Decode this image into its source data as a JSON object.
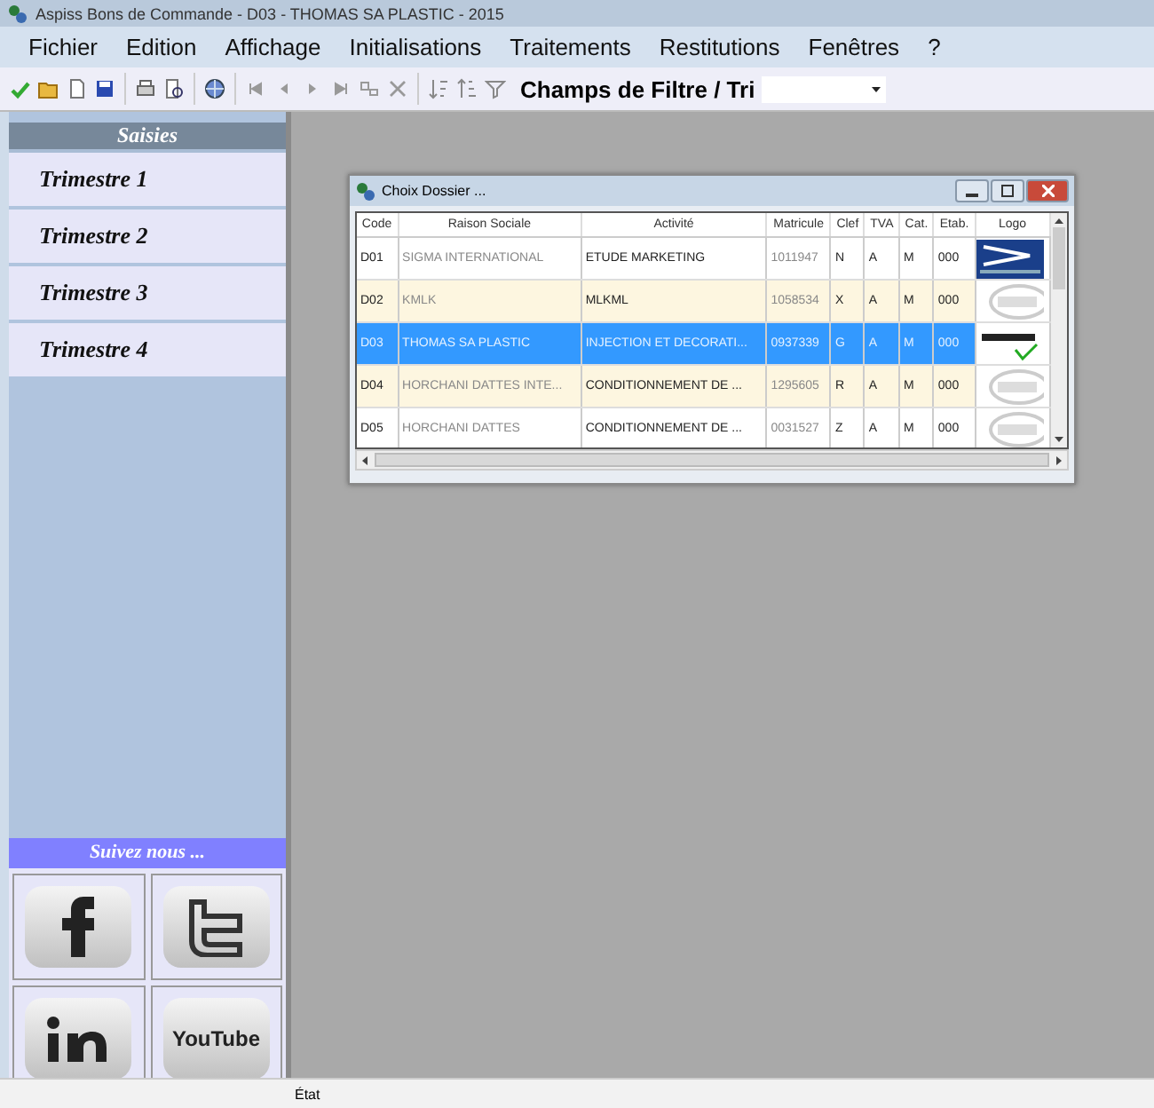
{
  "window": {
    "title": "Aspiss Bons de Commande - D03 - THOMAS SA PLASTIC - 2015"
  },
  "menu": [
    "Fichier",
    "Edition",
    "Affichage",
    "Initialisations",
    "Traitements",
    "Restitutions",
    "Fenêtres",
    "?"
  ],
  "toolbar": {
    "filter_label": "Champs de Filtre / Tri"
  },
  "sidebar": {
    "header": "Saisies",
    "items": [
      {
        "label": "Trimestre 1"
      },
      {
        "label": "Trimestre 2"
      },
      {
        "label": "Trimestre 3"
      },
      {
        "label": "Trimestre 4"
      }
    ],
    "social_header": "Suivez nous ...",
    "social": [
      {
        "kind": "facebook"
      },
      {
        "kind": "twitter"
      },
      {
        "kind": "linkedin"
      },
      {
        "kind": "youtube",
        "label": "YouTube"
      }
    ]
  },
  "dialog": {
    "title": "Choix Dossier ...",
    "columns": [
      "Code",
      "Raison Sociale",
      "Activité",
      "Matricule",
      "Clef",
      "TVA",
      "Cat.",
      "Etab.",
      "Logo"
    ],
    "rows": [
      {
        "cells": [
          "D01",
          "SIGMA INTERNATIONAL",
          "ETUDE MARKETING",
          "1011947",
          "N",
          "A",
          "M",
          "000"
        ],
        "kind": "sigma",
        "selected": false
      },
      {
        "cells": [
          "D02",
          "KMLK",
          "MLKML",
          "1058534",
          "X",
          "A",
          "M",
          "000"
        ],
        "kind": "blank",
        "selected": false
      },
      {
        "cells": [
          "D03",
          "THOMAS SA PLASTIC",
          "INJECTION ET DECORATI...",
          "0937339",
          "G",
          "A",
          "M",
          "000"
        ],
        "kind": "ttp",
        "selected": true
      },
      {
        "cells": [
          "D04",
          "HORCHANI DATTES INTE...",
          "CONDITIONNEMENT DE ...",
          "1295605",
          "R",
          "A",
          "M",
          "000"
        ],
        "kind": "blank",
        "selected": false
      },
      {
        "cells": [
          "D05",
          "HORCHANI DATTES",
          "CONDITIONNEMENT DE ...",
          "0031527",
          "Z",
          "A",
          "M",
          "000"
        ],
        "kind": "blank",
        "selected": false
      }
    ]
  },
  "status_bar": {
    "text": "État"
  }
}
